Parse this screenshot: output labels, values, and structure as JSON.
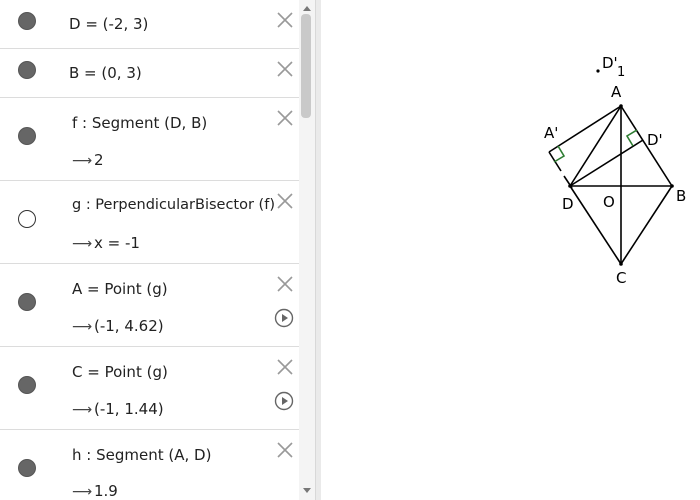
{
  "algebra": {
    "rows": [
      {
        "id": "D",
        "visible": true,
        "definition": "D = (-2, 3)",
        "value": null,
        "has_play": false
      },
      {
        "id": "B",
        "visible": true,
        "definition": "B = (0, 3)",
        "value": null,
        "has_play": false
      },
      {
        "id": "f",
        "visible": true,
        "definition": "f : Segment (D, B)",
        "value": "2",
        "has_play": false
      },
      {
        "id": "g",
        "visible": false,
        "definition": "g : PerpendicularBisector (f)",
        "value": "x = -1",
        "has_play": false
      },
      {
        "id": "A",
        "visible": true,
        "definition": "A = Point (g)",
        "value": "(-1, 4.62)",
        "has_play": true
      },
      {
        "id": "C",
        "visible": true,
        "definition": "C = Point (g)",
        "value": "(-1, 1.44)",
        "has_play": true
      },
      {
        "id": "h",
        "visible": true,
        "definition": "h : Segment (A, D)",
        "value": "1.9",
        "has_play": false
      }
    ],
    "arrow_symbol": "⟶",
    "icons": {
      "visibility": "marble-icon",
      "delete": "close-icon",
      "animate": "play-icon"
    }
  },
  "graphics": {
    "labels": {
      "A": "A",
      "B": "B",
      "C": "C",
      "D": "D",
      "O": "O",
      "A_prime": "A'",
      "D_prime": "D'",
      "D_prime_1_main": "D'",
      "D_prime_1_sub": "1"
    },
    "colors": {
      "lines": "#000000",
      "right_angle_marks": "#2e7d32",
      "points": "#000000"
    }
  }
}
